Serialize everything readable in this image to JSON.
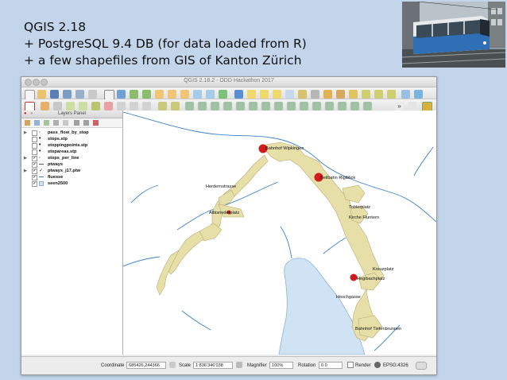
{
  "slide": {
    "lines": [
      "QGIS 2.18",
      "+ PostgreSQL 9.4 DB (for data loaded from R)",
      "+ a few shapefiles from GIS of Kanton Zürich"
    ]
  },
  "window": {
    "title": "QGIS 2.18.2 - ODD Hackathon 2017"
  },
  "layers_panel": {
    "title": "Layers Panel",
    "layers": [
      {
        "name": "pass_flow_by_stop",
        "checked": false,
        "symbol": "point"
      },
      {
        "name": "stops.stp",
        "checked": false,
        "symbol": "point"
      },
      {
        "name": "stoppingpoints.stp",
        "checked": false,
        "symbol": "point"
      },
      {
        "name": "stopareas.stp",
        "checked": false,
        "symbol": "point"
      },
      {
        "name": "stops_per_line",
        "checked": true,
        "symbol": "point"
      },
      {
        "name": "ptways",
        "checked": true,
        "symbol": "line"
      },
      {
        "name": "ptways_j17.ptw",
        "checked": true,
        "symbol": "polygon"
      },
      {
        "name": "fluesse",
        "checked": true,
        "symbol": "line"
      },
      {
        "name": "seen2500",
        "checked": true,
        "symbol": "polygon"
      }
    ]
  },
  "map": {
    "stops": [
      {
        "name": "Bahnhof Wipkingen"
      },
      {
        "name": "Seilbahn Rigiblick"
      },
      {
        "name": "Herdernstrasse"
      },
      {
        "name": "Albisriederplatz"
      },
      {
        "name": "Toblerplatz"
      },
      {
        "name": "Kirche Fluntern"
      },
      {
        "name": "Kreuzplatz"
      },
      {
        "name": "Hegibachplatz"
      },
      {
        "name": "Hoschgasse"
      },
      {
        "name": "Bahnhof Tiefenbrunnen"
      }
    ],
    "colors": {
      "ptways_fill": "#e6dfa8",
      "ptways_stroke": "#b8ad72",
      "rivers": "#3c83c6",
      "lake_fill": "#cfe3f4",
      "stop_marker": "#d01c1c"
    }
  },
  "statusbar": {
    "coordinate_label": "Coordinate",
    "coordinate_value": "685426,244366",
    "scale_label": "Scale",
    "scale_value": "1:836'346'038",
    "magnifier_label": "Magnifier",
    "magnifier_value": "100%",
    "rotation_label": "Rotation",
    "rotation_value": "0.0",
    "render_label": "Render",
    "crs_label": "EPSG:4326"
  }
}
